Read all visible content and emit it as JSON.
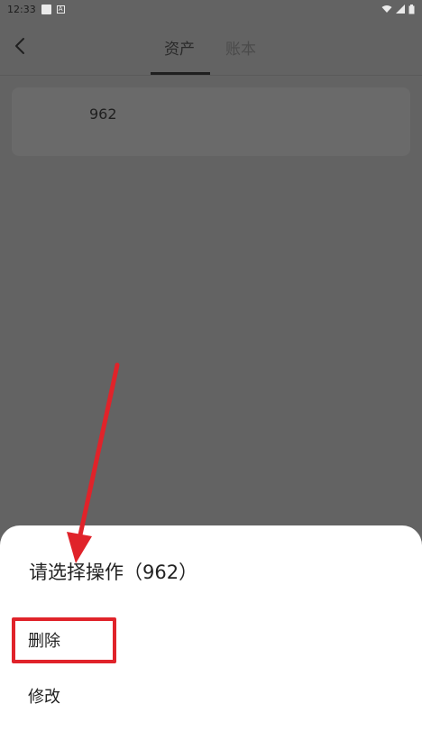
{
  "status_bar": {
    "time": "12:33",
    "icons": [
      "square-notification-icon",
      "a-notification-icon",
      "wifi-icon",
      "signal-icon",
      "battery-icon"
    ]
  },
  "app_bar": {
    "tabs": [
      {
        "label": "资产",
        "active": true
      },
      {
        "label": "账本",
        "active": false
      }
    ]
  },
  "asset_card": {
    "value": "962"
  },
  "sheet": {
    "title": "请选择操作（962）",
    "items": [
      {
        "label": "删除"
      },
      {
        "label": "修改"
      }
    ]
  },
  "colors": {
    "overlay": "#636363",
    "annotation": "#e0232a",
    "sheet_bg": "#ffffff"
  }
}
